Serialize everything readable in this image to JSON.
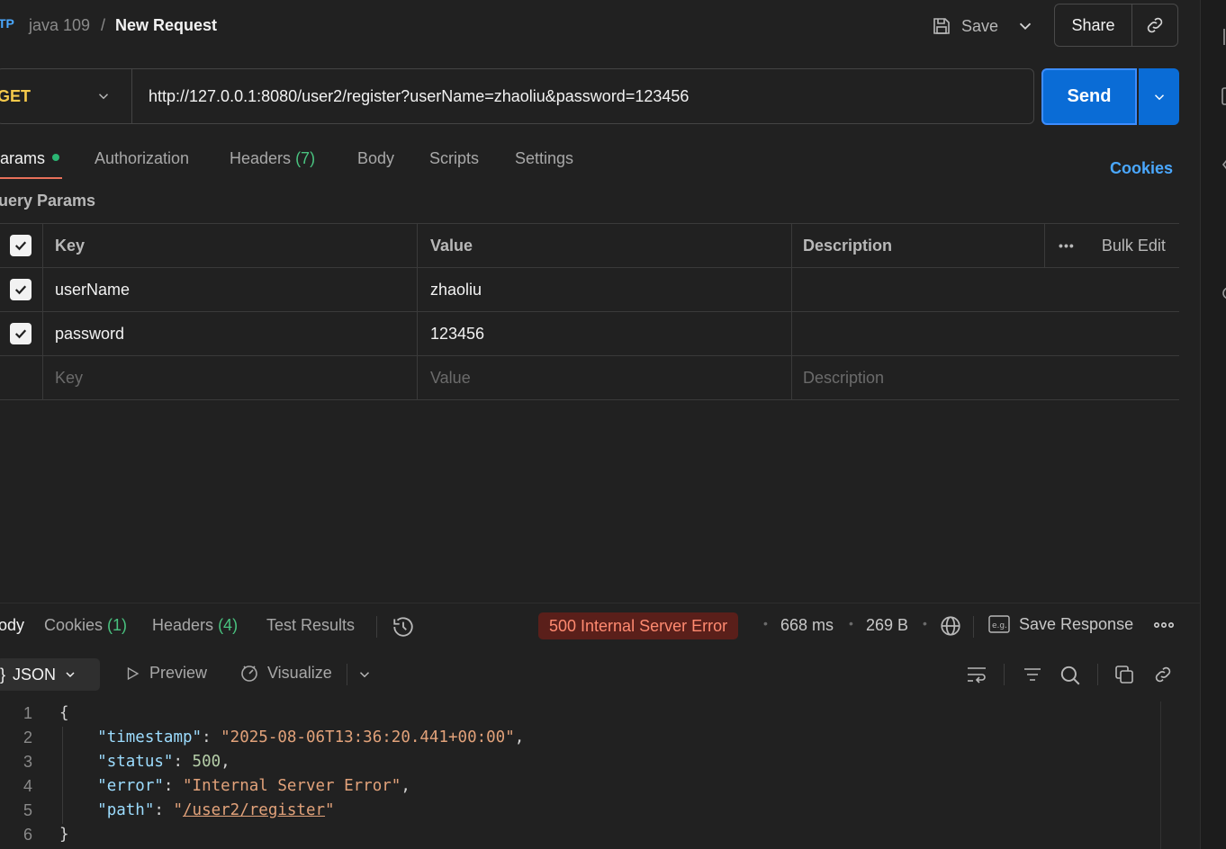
{
  "breadcrumb": {
    "icon_label": "TP",
    "parent": "java 109",
    "separator": "/",
    "title": "New Request"
  },
  "toolbar": {
    "save_label": "Save",
    "share_label": "Share"
  },
  "request": {
    "method": "GET",
    "url": "http://127.0.0.1:8080/user2/register?userName=zhaoliu&password=123456",
    "send_label": "Send"
  },
  "tabs": {
    "params": "arams",
    "authorization": "Authorization",
    "headers": "Headers",
    "headers_count": "(7)",
    "body": "Body",
    "scripts": "Scripts",
    "settings": "Settings",
    "cookies": "Cookies"
  },
  "query_params": {
    "title": "uery Params",
    "headers": {
      "key": "Key",
      "value": "Value",
      "description": "Description",
      "bulk_edit": "Bulk Edit"
    },
    "rows": [
      {
        "checked": true,
        "key": "userName",
        "value": "zhaoliu",
        "description": ""
      },
      {
        "checked": true,
        "key": "password",
        "value": "123456",
        "description": ""
      }
    ],
    "placeholder": {
      "key": "Key",
      "value": "Value",
      "description": "Description"
    }
  },
  "response": {
    "tabs": {
      "body": "ody",
      "cookies": "Cookies",
      "cookies_count": "(1)",
      "headers": "Headers",
      "headers_count": "(4)",
      "test_results": "Test Results"
    },
    "status": "500 Internal Server Error",
    "time": "668 ms",
    "size": "269 B",
    "save_response": "Save Response",
    "format": "JSON",
    "preview": "Preview",
    "visualize": "Visualize",
    "line_numbers": [
      "1",
      "2",
      "3",
      "4",
      "5",
      "6"
    ],
    "body": {
      "timestamp_key": "\"timestamp\"",
      "timestamp_val": "\"2025-08-06T13:36:20.441+00:00\"",
      "status_key": "\"status\"",
      "status_val": "500",
      "error_key": "\"error\"",
      "error_val": "\"Internal Server Error\"",
      "path_key": "\"path\"",
      "path_val": "/user2/register"
    }
  },
  "colors": {
    "accent_blue": "#0a6cd6",
    "method_get": "#f5c94b",
    "error_status": "#ff8a70",
    "active_tab_underline": "#e8705a"
  }
}
